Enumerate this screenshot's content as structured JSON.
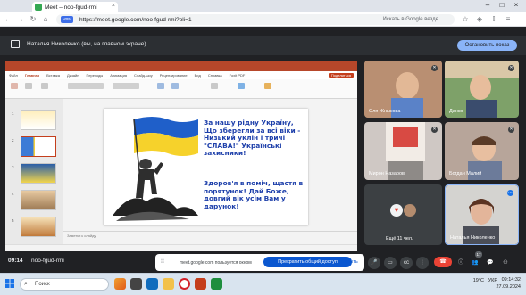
{
  "browser": {
    "tab_title": "Meet – noo-fgud-rmi",
    "url": "https://meet.google.com/noo-fgud-rmi?pli=1",
    "vpn_label": "VPN",
    "search_hint": "Искать в Google везде"
  },
  "meet": {
    "presenting_label": "Наталья Николенко (вы, на главном экране)",
    "stop_button": "Остановить показ",
    "time": "09:14",
    "meeting_code": "noo-fgud-rmi",
    "share_notice": "meet.google.com пользуется окном",
    "stop_sharing": "Прекратить общий доступ",
    "hide": "Скрыть",
    "participant_count": "17"
  },
  "ppt": {
    "tabs": [
      "Файл",
      "Главная",
      "Вставка",
      "Дизайн",
      "Переходы",
      "Анимация",
      "Слайд-шоу",
      "Рецензирование",
      "Вид",
      "Справка",
      "Foxit PDF"
    ],
    "share_label": "Поделиться",
    "notes_placeholder": "Заметки к слайду",
    "slide_numbers": [
      "1",
      "2",
      "3",
      "4",
      "5"
    ]
  },
  "slide": {
    "poem_1": "За нашу рідну Україну, Що зберегли за всі віки - Низький уклін і тричі \"СЛАВА!\" Українські захисники!",
    "poem_2": "Здоров'я в поміч, щастя в порятунок! Дай Боже, довгий вік усім Вам у дарунок!"
  },
  "participants": {
    "p1": "Оля Жныкова",
    "p2": "Данко",
    "p3": "Мирон Назаров",
    "p4": "Богдан Малий",
    "more": "Ещё 11 чел.",
    "self": "Наталья Николенко"
  },
  "taskbar": {
    "search": "Поиск",
    "temp": "19°C",
    "lang": "УКР",
    "clock": "09:14:32",
    "date": "27.09.2024"
  }
}
